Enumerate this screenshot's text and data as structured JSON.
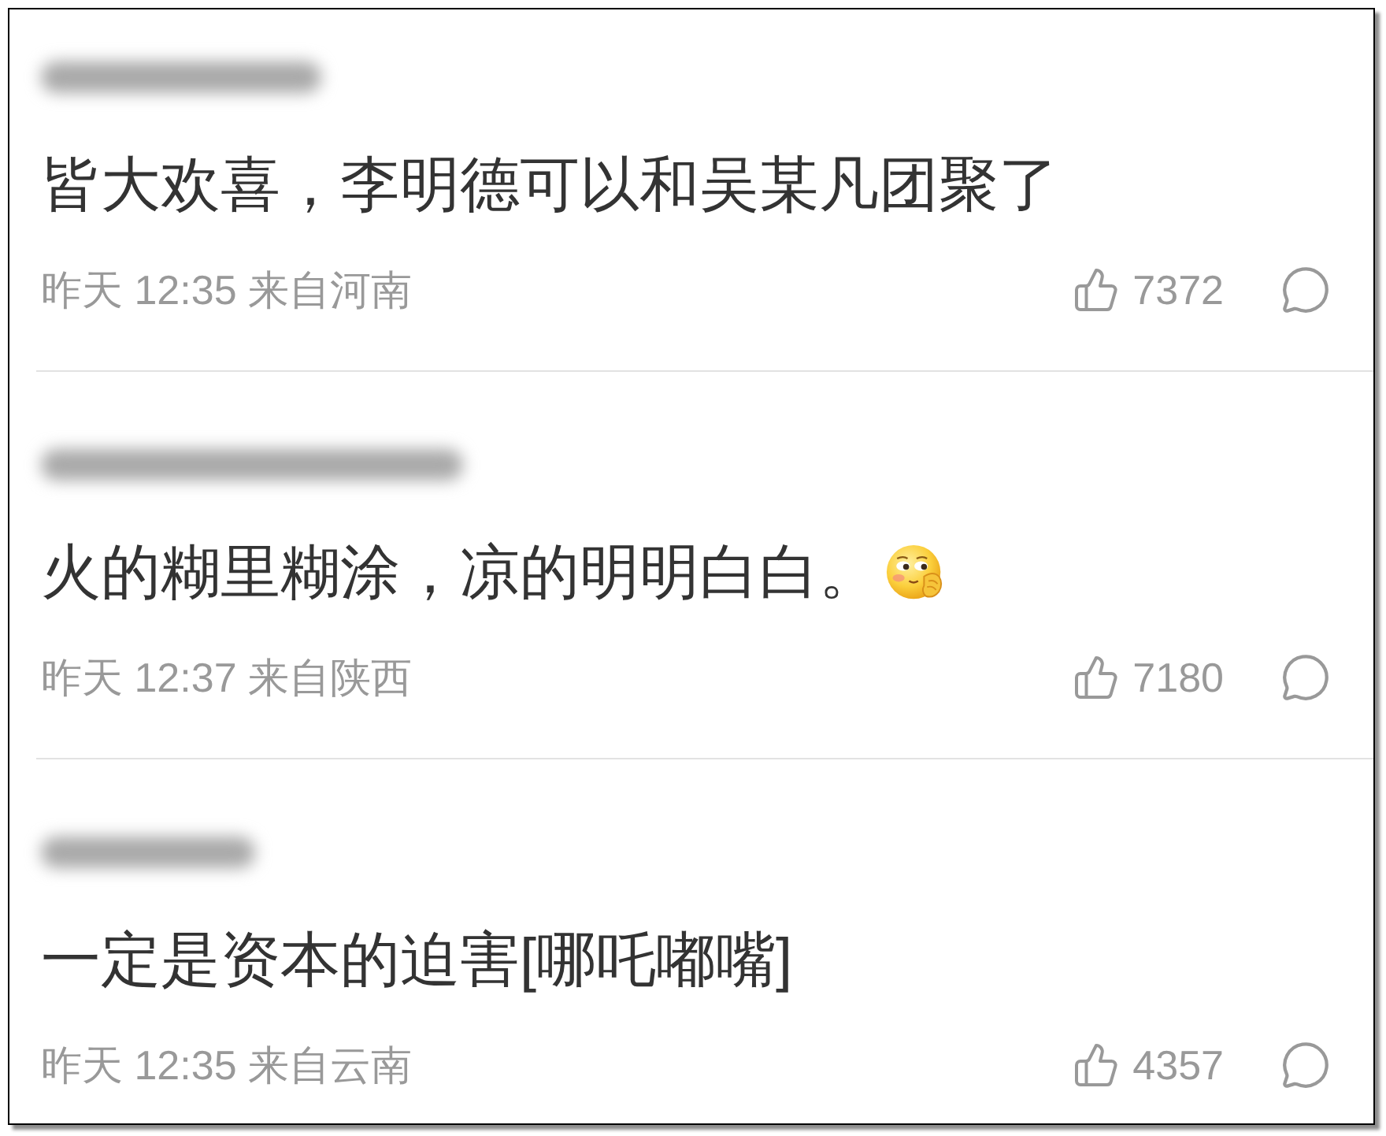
{
  "comments": [
    {
      "body": [
        {
          "kind": "text",
          "text": "皆大欢喜，李明德可以和吴某凡团聚了"
        }
      ],
      "meta": "昨天 12:35 来自河南",
      "likes": "7372"
    },
    {
      "body": [
        {
          "kind": "text",
          "text": "火的糊里糊涂，凉的明明白白。"
        },
        {
          "kind": "emoji"
        }
      ],
      "meta": "昨天 12:37 来自陕西",
      "likes": "7180"
    },
    {
      "body": [
        {
          "kind": "text",
          "text": "一定是资本的迫害[哪吒嘟嘴]"
        }
      ],
      "meta": "昨天 12:35 来自云南",
      "likes": "4357"
    }
  ]
}
